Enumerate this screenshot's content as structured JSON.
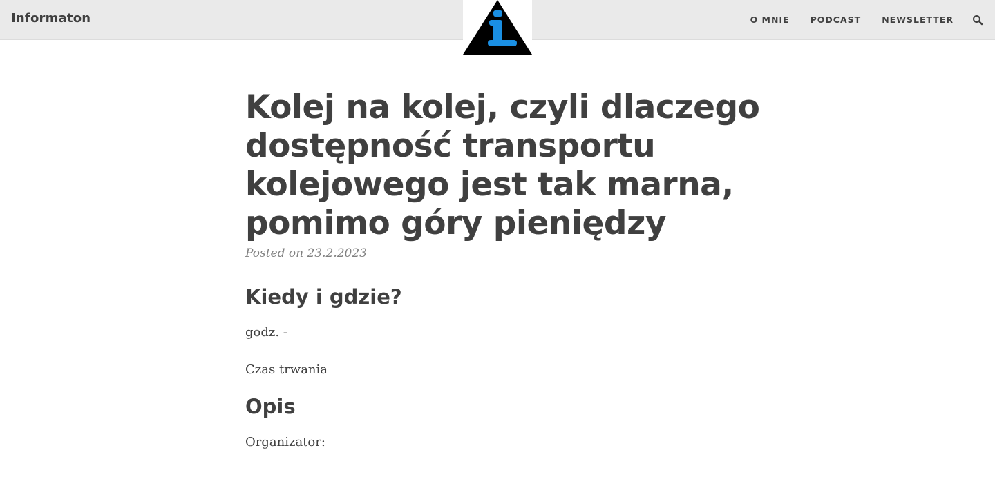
{
  "header": {
    "brand": "Informaton",
    "nav": [
      {
        "label": "O MNIE"
      },
      {
        "label": "PODCAST"
      },
      {
        "label": "NEWSLETTER"
      }
    ],
    "logo_colors": {
      "triangle": "#000000",
      "letter": "#1a8fe3"
    }
  },
  "post": {
    "title": "Kolej na kolej, czyli dlaczego dostępność transportu kolejowego jest tak marna, pomimo góry pieniędzy",
    "meta": "Posted on 23.2.2023",
    "sections": [
      {
        "heading": "Kiedy i gdzie?",
        "paragraphs": [
          "godz. -",
          "Czas trwania"
        ]
      },
      {
        "heading": "Opis",
        "paragraphs": [
          "Organizator:"
        ]
      }
    ]
  }
}
